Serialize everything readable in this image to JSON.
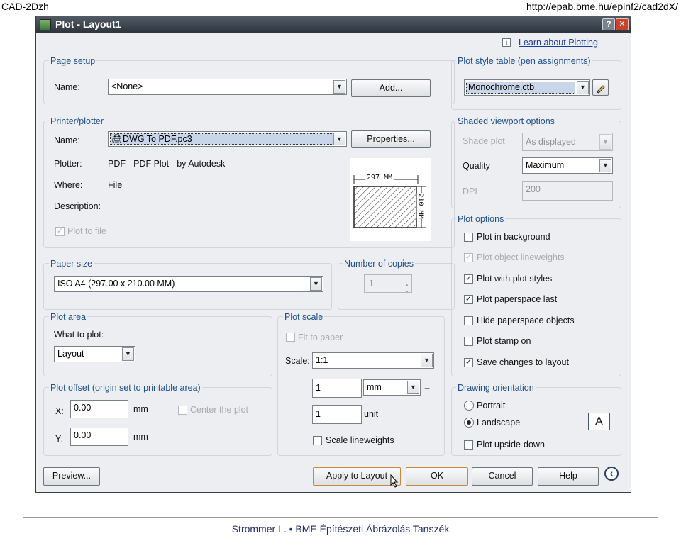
{
  "slide": {
    "header_left": "CAD-2Dzh",
    "header_right": "http://epab.bme.hu/epinf2/cad2dX/",
    "footer": "Strommer L. • BME Építészeti Ábrázolás Tanszék"
  },
  "dialog": {
    "title": "Plot - Layout1",
    "help_btn": "?",
    "close_btn": "✕",
    "learn_link": "Learn about Plotting",
    "info_icon": "i",
    "page_setup": {
      "title": "Page setup",
      "name_label": "Name:",
      "name_value": "<None>",
      "add_button": "Add..."
    },
    "printer": {
      "title": "Printer/plotter",
      "name_label": "Name:",
      "name_value": "DWG To PDF.pc3",
      "properties_button": "Properties...",
      "plotter_label": "Plotter:",
      "plotter_value": "PDF - PDF Plot - by Autodesk",
      "where_label": "Where:",
      "where_value": "File",
      "description_label": "Description:",
      "plot_to_file": "Plot to file",
      "preview_width": "297 MM",
      "preview_height": "210 MM"
    },
    "paper_size": {
      "title": "Paper size",
      "value": "ISO A4 (297.00 x 210.00 MM)"
    },
    "copies": {
      "title": "Number of copies",
      "value": "1"
    },
    "plot_area": {
      "title": "Plot area",
      "what_label": "What to plot:",
      "what_value": "Layout"
    },
    "plot_offset": {
      "title": "Plot offset (origin set to printable area)",
      "x_label": "X:",
      "x_value": "0.00",
      "x_unit": "mm",
      "y_label": "Y:",
      "y_value": "0.00",
      "y_unit": "mm",
      "center_label": "Center the plot"
    },
    "plot_scale": {
      "title": "Plot scale",
      "fit_label": "Fit to paper",
      "scale_label": "Scale:",
      "scale_value": "1:1",
      "mm_value": "1",
      "mm_unit": "mm",
      "equals": "=",
      "unit_value": "1",
      "unit_label": "unit",
      "lineweights_label": "Scale lineweights"
    },
    "plot_style": {
      "title": "Plot style table (pen assignments)",
      "value": "Monochrome.ctb"
    },
    "shaded": {
      "title": "Shaded viewport options",
      "shade_label": "Shade plot",
      "shade_value": "As displayed",
      "quality_label": "Quality",
      "quality_value": "Maximum",
      "dpi_label": "DPI",
      "dpi_value": "200"
    },
    "plot_options": {
      "title": "Plot options",
      "background": "Plot in background",
      "lineweights": "Plot object lineweights",
      "styles": "Plot with plot styles",
      "paperspace_last": "Plot paperspace last",
      "hide": "Hide paperspace objects",
      "stamp": "Plot stamp on",
      "save": "Save changes to layout"
    },
    "orientation": {
      "title": "Drawing orientation",
      "portrait": "Portrait",
      "landscape": "Landscape",
      "upside_down": "Plot upside-down",
      "icon_letter": "A"
    },
    "buttons": {
      "preview": "Preview...",
      "apply": "Apply to Layout",
      "ok": "OK",
      "cancel": "Cancel",
      "help": "Help"
    }
  }
}
